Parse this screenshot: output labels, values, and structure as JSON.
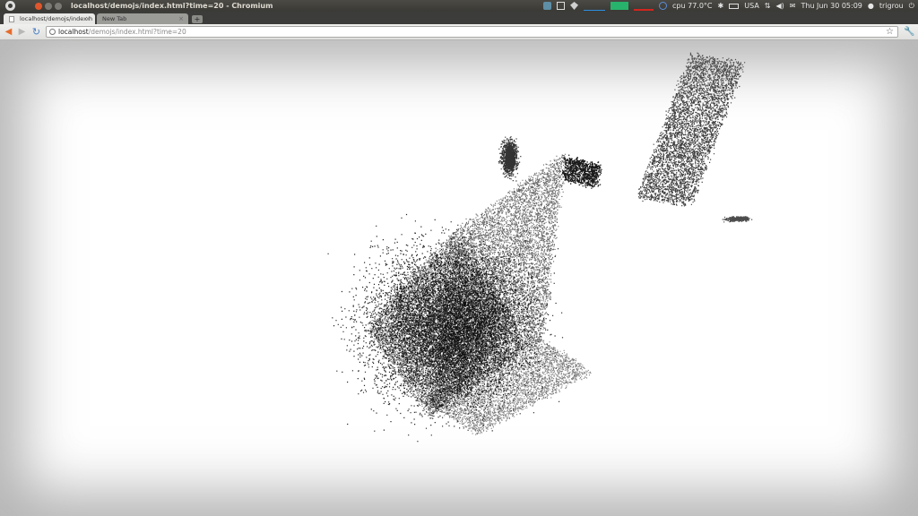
{
  "panel": {
    "window_title": "localhost/demojs/index.html?time=20 - Chromium",
    "cpu": "cpu 77.0°C",
    "keyboard": "USA",
    "clock": "Thu Jun 30 05:09",
    "user": "trigrou"
  },
  "tabs": [
    {
      "label": "localhost/demojs/index.h"
    },
    {
      "label": "New Tab"
    }
  ],
  "newtab_label": "+",
  "address": {
    "host": "localhost",
    "path": "/demojs/index.html?time=20"
  },
  "icons": {
    "back": "back-arrow-icon",
    "forward": "forward-arrow-icon",
    "reload": "reload-icon",
    "bookmark": "star-icon",
    "menu": "wrench-icon"
  },
  "colors": {
    "panel_bg": "#3c3b37",
    "close_button": "#e0562c",
    "back_arrow": "#e66c2c",
    "reload": "#4a80c8",
    "particles": "#000000"
  }
}
